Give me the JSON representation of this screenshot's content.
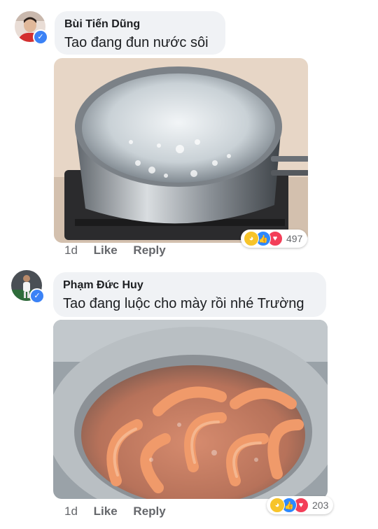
{
  "comments": [
    {
      "author": "Bùi Tiến Dũng",
      "text": "Tao đang đun nước sôi",
      "time": "1d",
      "like_label": "Like",
      "reply_label": "Reply",
      "reaction_count": "497",
      "reaction_icons": [
        "haha-icon",
        "like-icon",
        "love-icon"
      ]
    },
    {
      "author": "Phạm Đức Huy",
      "text": "Tao đang luộc cho mày rồi nhé Trường",
      "time": "1d",
      "like_label": "Like",
      "reply_label": "Reply",
      "reaction_count": "203",
      "reaction_icons": [
        "haha-icon",
        "like-icon",
        "love-icon"
      ]
    }
  ],
  "colors": {
    "bubble": "#f0f2f5",
    "action_text": "#65676b",
    "verified": "#3b82f6",
    "like": "#2d88ff",
    "love": "#f33e58",
    "haha": "#f7c42a"
  }
}
